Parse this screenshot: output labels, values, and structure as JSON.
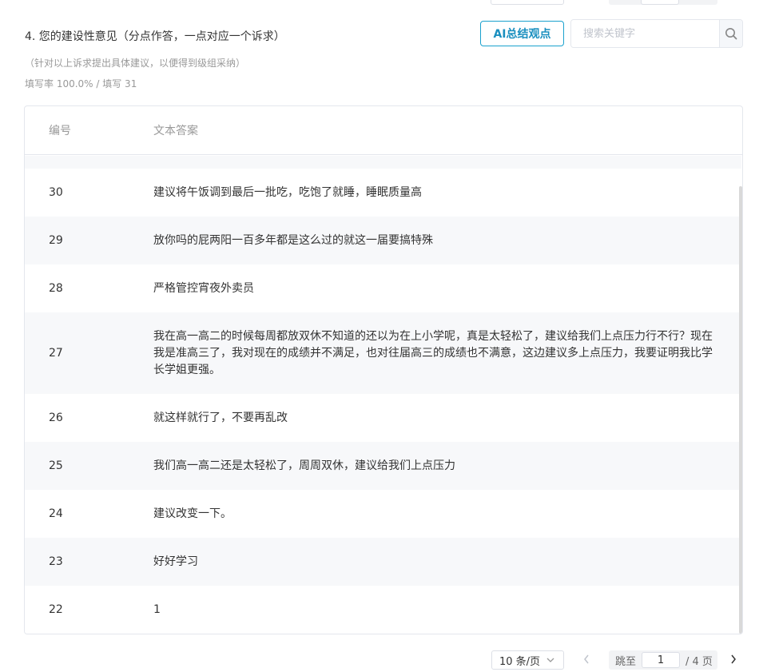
{
  "question": {
    "title": "4. 您的建设性意见（分点作答，一点对应一个诉求）",
    "hint": "（针对以上诉求提出具体建议，以便得到级组采纳）",
    "fill_rate": "填写率 100.0% / 填写 31"
  },
  "toolbar": {
    "ai_button_label": "AI总结观点",
    "search_placeholder": "搜索关键字",
    "search_icon": "search-icon"
  },
  "table": {
    "headers": {
      "id": "编号",
      "answer": "文本答案"
    },
    "rows": [
      {
        "id": "30",
        "text": "建议将午饭调到最后一批吃，吃饱了就睡，睡眠质量高"
      },
      {
        "id": "29",
        "text": "放你吗的屁两阳一百多年都是这么过的就这一届要搞特殊"
      },
      {
        "id": "28",
        "text": "严格管控宵夜外卖员"
      },
      {
        "id": "27",
        "text": "我在高一高二的时候每周都放双休不知道的还以为在上小学呢，真是太轻松了，建议给我们上点压力行不行？现在我是准高三了，我对现在的成绩并不满足，也对往届高三的成绩也不满意，这边建议多上点压力，我要证明我比学长学姐更强。"
      },
      {
        "id": "26",
        "text": "就这样就行了，不要再乱改"
      },
      {
        "id": "25",
        "text": "我们高一高二还是太轻松了，周周双休，建议给我们上点压力"
      },
      {
        "id": "24",
        "text": "建议改变一下。"
      },
      {
        "id": "23",
        "text": "好好学习"
      },
      {
        "id": "22",
        "text": "1"
      }
    ]
  },
  "pagination": {
    "page_size": "10 条/页",
    "jump_label": "跳至",
    "current_page": "1",
    "total_pages": "/ 4 页",
    "prev_icon": "chevron-left-icon",
    "next_icon": "chevron-right-icon"
  }
}
